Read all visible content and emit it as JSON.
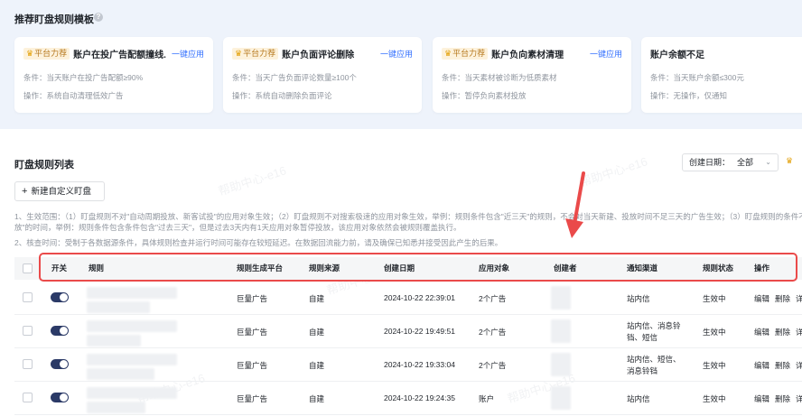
{
  "templates": {
    "title": "推荐盯盘规则模板",
    "help_icon": "?",
    "cards": [
      {
        "tag": "平台力荐",
        "name": "账户在投广告配额撞线...",
        "apply": "一键应用",
        "condition": "条件：当天账户在投广告配额≥90%",
        "action": "操作：系统自动清理低效广告"
      },
      {
        "tag": "平台力荐",
        "name": "账户负面评论删除",
        "apply": "一键应用",
        "condition": "条件：当天广告负面评论数量≥100个",
        "action": "操作：系统自动删除负面评论"
      },
      {
        "tag": "平台力荐",
        "name": "账户负向素材清理",
        "apply": "一键应用",
        "condition": "条件：当天素材被诊断为低质素材",
        "action": "操作：暂停负向素材投放"
      },
      {
        "tag": "",
        "name": "账户余额不足",
        "apply": "",
        "condition": "条件：当天账户余额≤300元",
        "action": "操作：无操作，仅通知"
      }
    ]
  },
  "list": {
    "title": "盯盘规则列表",
    "filter_label": "创建日期：",
    "filter_value": "全部",
    "new_button": "新建自定义盯盘",
    "notes": [
      "1、生效范围：（1）盯盘规则不对\"自动周期投放、新客试投\"的应用对象生效；（2）盯盘规则不对搜索极速的应用对象生效，举例：规则条件包含\"近三天\"的规则，不会对当天新建、投放时间不足三天的广告生效；（3）盯盘规则的条件不会",
      "放\"的时间，举例：规则条件包含条件包含\"过去三天\"，但是过去3天内有1天应用对象暂停投放，该应用对象依然会被规则覆盖执行。",
      "2、核查时间：受制于各数据源条件，具体规则检查并运行时间可能存在较短延迟。在数据回流能力前，请及确保已知悉并接受因此产生的后果。"
    ],
    "columns": [
      "开关",
      "规则",
      "规则生成平台",
      "规则来源",
      "创建日期",
      "应用对象",
      "创建者",
      "通知渠道",
      "规则状态",
      "操作"
    ],
    "rows": [
      {
        "platform": "巨量广告",
        "source": "自建",
        "date": "2024-10-22 22:39:01",
        "target": "2个广告",
        "channel": "站内信",
        "channel2": "",
        "status": "生效中",
        "edit": "编辑",
        "del": "删除",
        "more": "详"
      },
      {
        "platform": "巨量广告",
        "source": "自建",
        "date": "2024-10-22 19:49:51",
        "target": "2个广告",
        "channel": "站内信、消息铃",
        "channel2": "铛、短信",
        "status": "生效中",
        "edit": "编辑",
        "del": "删除",
        "more": "详"
      },
      {
        "platform": "巨量广告",
        "source": "自建",
        "date": "2024-10-22 19:33:04",
        "target": "2个广告",
        "channel": "站内信、短信、",
        "channel2": "消息铃铛",
        "status": "生效中",
        "edit": "编辑",
        "del": "删除",
        "more": "详"
      },
      {
        "platform": "巨量广告",
        "source": "自建",
        "date": "2024-10-22 19:24:35",
        "target": "账户",
        "channel": "站内信",
        "channel2": "",
        "status": "生效中",
        "edit": "编辑",
        "del": "删除",
        "more": "详"
      }
    ]
  },
  "watermark": "帮助中心-e16",
  "colors": {
    "accent": "#3370ff",
    "highlight": "#ea4a4a",
    "toggle_on": "#2b3a67"
  }
}
